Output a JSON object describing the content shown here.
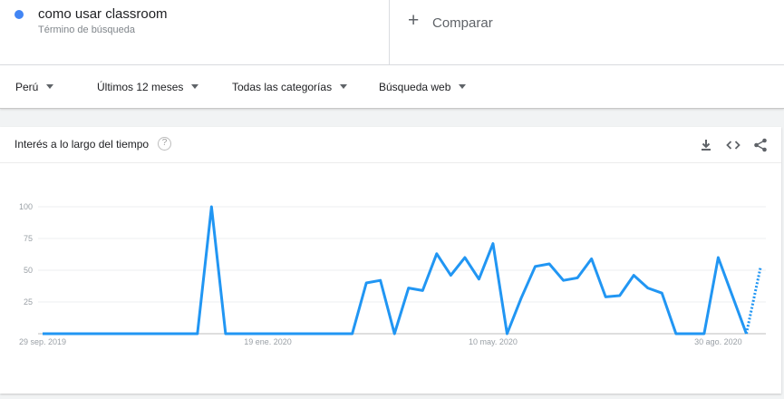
{
  "term": {
    "name": "como usar classroom",
    "type": "Término de búsqueda",
    "color": "#4285f4"
  },
  "compare": {
    "label": "Comparar"
  },
  "filters": {
    "region": "Perú",
    "period": "Últimos 12 meses",
    "category": "Todas las categorías",
    "search_type": "Búsqueda web"
  },
  "card": {
    "title": "Interés a lo largo del tiempo",
    "icons": [
      "help-icon",
      "download-icon",
      "embed-icon",
      "share-icon"
    ]
  },
  "chart_data": {
    "type": "line",
    "series_color": "#2196f3",
    "yticks": [
      100,
      75,
      50,
      25
    ],
    "ylim": [
      0,
      100
    ],
    "xtick_labels": [
      "29 sep. 2019",
      "19 ene. 2020",
      "10 may. 2020",
      "30 ago. 2020"
    ],
    "xtick_week_index": [
      0,
      16,
      32,
      48
    ],
    "values": [
      0,
      0,
      0,
      0,
      0,
      0,
      0,
      0,
      0,
      0,
      0,
      0,
      100,
      0,
      0,
      0,
      0,
      0,
      0,
      0,
      0,
      0,
      0,
      40,
      42,
      0,
      36,
      34,
      63,
      46,
      60,
      43,
      71,
      0,
      28,
      53,
      55,
      42,
      44,
      59,
      29,
      30,
      46,
      36,
      32,
      0,
      0,
      0,
      60,
      30,
      0
    ],
    "partial_values": [
      0,
      52
    ],
    "grid": true
  }
}
